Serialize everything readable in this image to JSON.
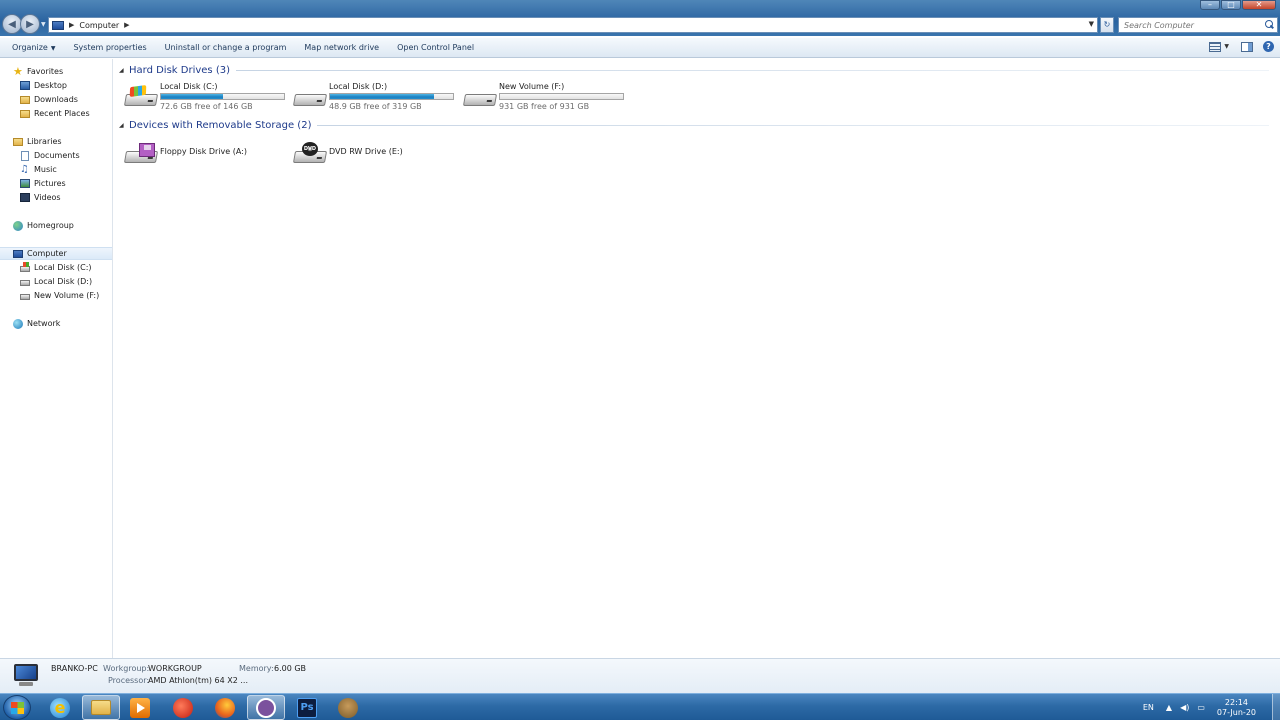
{
  "window": {
    "controls": [
      "minimize",
      "maximize",
      "close"
    ]
  },
  "address": {
    "location": "Computer",
    "search_placeholder": "Search Computer"
  },
  "toolbar": {
    "organize": "Organize",
    "system_properties": "System properties",
    "uninstall": "Uninstall or change a program",
    "map_drive": "Map network drive",
    "control_panel": "Open Control Panel"
  },
  "nav": {
    "favorites": "Favorites",
    "desktop": "Desktop",
    "downloads": "Downloads",
    "recent": "Recent Places",
    "libraries": "Libraries",
    "documents": "Documents",
    "music": "Music",
    "pictures": "Pictures",
    "videos": "Videos",
    "homegroup": "Homegroup",
    "computer": "Computer",
    "disk_c": "Local Disk (C:)",
    "disk_d": "Local Disk (D:)",
    "disk_f": "New Volume (F:)",
    "network": "Network"
  },
  "groups": {
    "hard_disks": "Hard Disk Drives (3)",
    "removable": "Devices with Removable Storage (2)"
  },
  "drives": [
    {
      "name": "Local Disk (C:)",
      "free_text": "72.6 GB free of 146 GB",
      "used_fraction": 0.503,
      "icon": "windows-drive-icon"
    },
    {
      "name": "Local Disk (D:)",
      "free_text": "48.9 GB free of 319 GB",
      "used_fraction": 0.847,
      "icon": "hard-drive-icon"
    },
    {
      "name": "New Volume (F:)",
      "free_text": "931 GB free of 931 GB",
      "used_fraction": 0.0,
      "icon": "hard-drive-icon"
    }
  ],
  "removable": [
    {
      "name": "Floppy Disk Drive (A:)",
      "icon": "floppy-drive-icon"
    },
    {
      "name": "DVD RW Drive (E:)",
      "icon": "dvd-drive-icon",
      "badge": "DVD"
    }
  ],
  "details": {
    "pc_name": "BRANKO-PC",
    "workgroup_label": "Workgroup:",
    "workgroup": "WORKGROUP",
    "memory_label": "Memory:",
    "memory": "6.00 GB",
    "processor_label": "Processor:",
    "processor": "AMD Athlon(tm) 64 X2 ..."
  },
  "taskbar": {
    "apps": [
      "internet-explorer-icon",
      "windows-explorer-icon",
      "media-player-icon",
      "red-app-icon",
      "firefox-icon",
      "viber-icon",
      "photoshop-icon",
      "gimp-icon"
    ],
    "ps_label": "Ps",
    "ie_label": "e",
    "lang": "EN",
    "time": "22:14",
    "date": "07-Jun-20"
  },
  "colors": {
    "accent": "#1e3a8a",
    "bar_fill": "#1a7fc0",
    "taskbar": "#2d6aa6"
  }
}
